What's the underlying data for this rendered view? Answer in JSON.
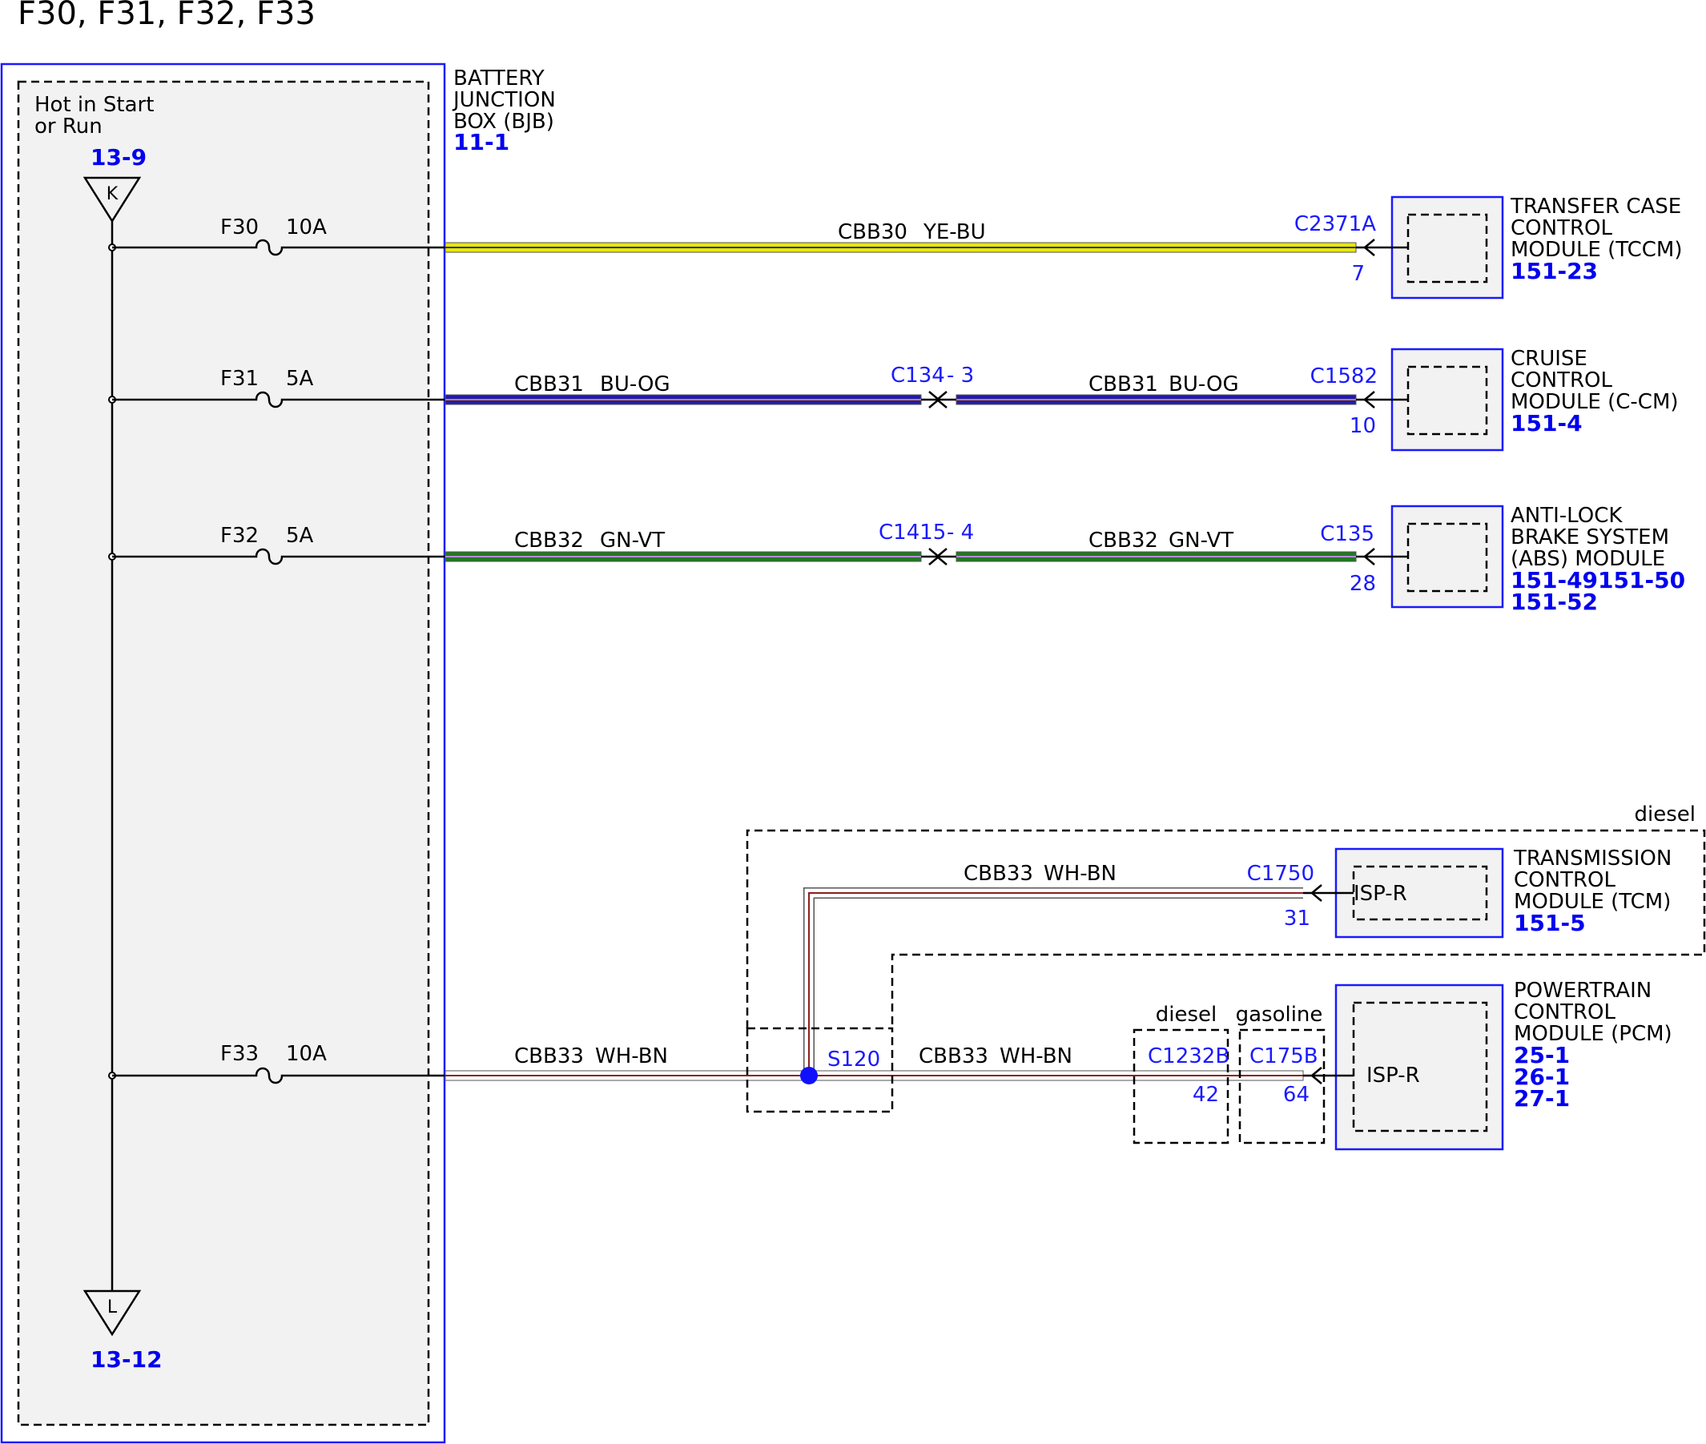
{
  "title": "F30, F31, F32, F33",
  "colors": {
    "module_border": "#1a1aff",
    "ref_text": "#0000ee",
    "connector_text": "#1a1aff",
    "box_fill": "#f2f2f2",
    "ye_bu": "#e8e800",
    "bu_og": "#1c1cb4",
    "gn_vt": "#1f7a1f",
    "wh_bn": "#8b2020",
    "splice": "#1010ff"
  },
  "bjb": {
    "power_label": [
      "Hot in Start",
      "or Run"
    ],
    "name_lines": [
      "BATTERY",
      "JUNCTION",
      "BOX (BJB)"
    ],
    "ref": "11-1",
    "top_connector": {
      "letter": "K",
      "ref": "13-9"
    },
    "bottom_connector": {
      "letter": "L",
      "ref": "13-12"
    }
  },
  "fuses": [
    {
      "id": "F30",
      "rating": "10A"
    },
    {
      "id": "F31",
      "rating": "5A"
    },
    {
      "id": "F32",
      "rating": "5A"
    },
    {
      "id": "F33",
      "rating": "10A"
    }
  ],
  "circuits": {
    "f30": {
      "circuit": "CBB30",
      "color": "YE-BU",
      "connector": "C2371A",
      "pin": "7"
    },
    "f31": {
      "seg1_circuit": "CBB31",
      "seg1_color": "BU-OG",
      "inline_connector": "C134",
      "inline_pin": "- 3",
      "seg2_circuit": "CBB31",
      "seg2_color": "BU-OG",
      "connector": "C1582",
      "pin": "10"
    },
    "f32": {
      "seg1_circuit": "CBB32",
      "seg1_color": "GN-VT",
      "inline_connector": "C1415",
      "inline_pin": "- 4",
      "seg2_circuit": "CBB32",
      "seg2_color": "GN-VT",
      "connector": "C135",
      "pin": "28"
    },
    "f33": {
      "seg1_circuit": "CBB33",
      "seg1_color": "WH-BN",
      "splice": "S120",
      "tcm_circuit": "CBB33",
      "tcm_color": "WH-BN",
      "tcm_connector": "C1750",
      "tcm_pin": "31",
      "pcm_circuit": "CBB33",
      "pcm_color": "WH-BN",
      "diesel_connector": "C1232B",
      "diesel_pin": "42",
      "gasoline_connector": "C175B",
      "gasoline_pin": "64",
      "diesel_label": "diesel",
      "gasoline_label": "gasoline",
      "region_label": "diesel"
    }
  },
  "modules": {
    "tccm": {
      "name_lines": [
        "TRANSFER CASE",
        "CONTROL",
        "MODULE (TCCM)"
      ],
      "refs": [
        "151-23"
      ]
    },
    "ccm": {
      "name_lines": [
        "CRUISE",
        "CONTROL",
        "MODULE (C-CM)"
      ],
      "refs": [
        "151-4"
      ]
    },
    "abs": {
      "name_lines": [
        "ANTI-LOCK",
        "BRAKE SYSTEM",
        "(ABS) MODULE"
      ],
      "refs": [
        "151-49151-50",
        "151-52"
      ]
    },
    "tcm": {
      "name_lines": [
        "TRANSMISSION",
        "CONTROL",
        "MODULE (TCM)"
      ],
      "refs": [
        "151-5"
      ],
      "internal": "ISP-R"
    },
    "pcm": {
      "name_lines": [
        "POWERTRAIN",
        "CONTROL",
        "MODULE (PCM)"
      ],
      "refs": [
        "25-1",
        "26-1",
        "27-1"
      ],
      "internal": "ISP-R"
    }
  }
}
